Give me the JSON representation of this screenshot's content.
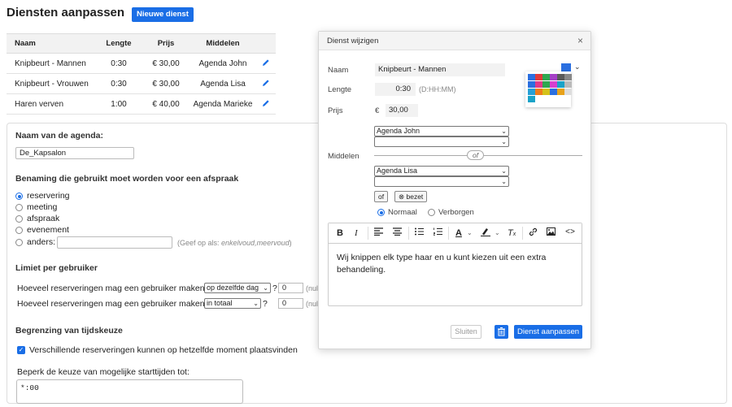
{
  "page": {
    "title": "Diensten aanpassen",
    "new_button": "Nieuwe dienst"
  },
  "services": {
    "headers": [
      "Naam",
      "Lengte",
      "Prijs",
      "Middelen"
    ],
    "rows": [
      {
        "name": "Knipbeurt - Mannen",
        "length": "0:30",
        "price": "€ 30,00",
        "resource": "Agenda John"
      },
      {
        "name": "Knipbeurt - Vrouwen",
        "length": "0:30",
        "price": "€ 30,00",
        "resource": "Agenda Lisa"
      },
      {
        "name": "Haren verven",
        "length": "1:00",
        "price": "€ 40,00",
        "resource": "Agenda Marieke"
      }
    ]
  },
  "settings": {
    "agenda_name_label": "Naam van de agenda:",
    "agenda_name_value": "De_Kapsalon",
    "naming_label": "Benaming die gebruikt moet worden voor een afspraak",
    "naming_options": [
      "reservering",
      "meeting",
      "afspraak",
      "evenement",
      "anders:"
    ],
    "naming_selected": "reservering",
    "naming_hint_prefix": "(Geef op als: ",
    "naming_hint_italic": "enkelvoud,meervoud",
    "naming_hint_suffix": ")",
    "limit_label": "Limiet per gebruiker",
    "limit_q": "Hoeveel reserveringen mag een gebruiker maken",
    "limit_rows": [
      {
        "select": "op dezelfde dag",
        "value": "0",
        "hint": "(nul"
      },
      {
        "select": "in totaal",
        "value": "0",
        "hint": "(nul"
      }
    ],
    "qmark": "?",
    "timechoice_label": "Begrenzing van tijdskeuze",
    "overlap_label": "Verschillende reserveringen kunnen op hetzelfde moment plaatsvinden",
    "overlap_checked": true,
    "starttimes_label": "Beperk de keuze van mogelijke starttijden tot:",
    "starttimes_value": "*:00"
  },
  "modal": {
    "title": "Dienst wijzigen",
    "name_label": "Naam",
    "name_value": "Knipbeurt - Mannen",
    "length_label": "Lengte",
    "length_value": "0:30",
    "length_hint": "(D:HH:MM)",
    "price_label": "Prijs",
    "currency": "€",
    "price_value": "30,00",
    "resources_label": "Middelen",
    "resource_group1": "Agenda John",
    "resource_group2": "Agenda Lisa",
    "or_label": "of",
    "or_button": "of",
    "busy_button": "⊗ bezet",
    "visibility_options": [
      "Normaal",
      "Verborgen"
    ],
    "visibility_selected": "Normaal",
    "description": "Wij knippen elk type haar en u kunt kiezen uit een extra behandeling.",
    "close_button": "Sluiten",
    "save_button": "Dienst aanpassen",
    "color_selected": "#2b6fe0",
    "palette": [
      "#2b6fe0",
      "#e03a3a",
      "#2fa84f",
      "#a43fc6",
      "#7a7a7a",
      "#888888",
      "#2b6fe0",
      "#e03a8a",
      "#2fa84f",
      "#d63fd0",
      "#1aa3c8",
      "#bbbbbb",
      "#26a0d6",
      "#f07c1a",
      "#d4c21a",
      "#2b6fe0",
      "#e8a21a",
      "#ffffff",
      "#1aa3c8",
      "#ffffff",
      "#ffffff",
      "#ffffff",
      "#ffffff",
      "#ffffff"
    ]
  }
}
